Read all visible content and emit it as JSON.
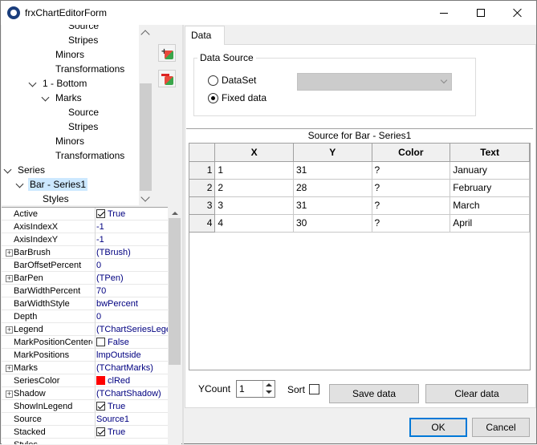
{
  "window": {
    "title": "frxChartEditorForm"
  },
  "tree": {
    "items": [
      {
        "label": "Source",
        "indent": 4,
        "arrow": false
      },
      {
        "label": "Stripes",
        "indent": 4,
        "arrow": false
      },
      {
        "label": "Minors",
        "indent": 3,
        "arrow": false
      },
      {
        "label": "Transformations",
        "indent": 3,
        "arrow": false
      },
      {
        "label": "1 - Bottom",
        "indent": 2,
        "arrow": true
      },
      {
        "label": "Marks",
        "indent": 3,
        "arrow": true
      },
      {
        "label": "Source",
        "indent": 4,
        "arrow": false
      },
      {
        "label": "Stripes",
        "indent": 4,
        "arrow": false
      },
      {
        "label": "Minors",
        "indent": 3,
        "arrow": false
      },
      {
        "label": "Transformations",
        "indent": 3,
        "arrow": false
      },
      {
        "label": "Series",
        "indent": 0,
        "arrow": true
      },
      {
        "label": "Bar - Series1",
        "indent": 1,
        "arrow": true,
        "selected": true
      },
      {
        "label": "Styles",
        "indent": 2,
        "arrow": false
      }
    ]
  },
  "toolbar": {
    "add_icon": "add-series-icon",
    "remove_icon": "remove-series-icon"
  },
  "inspector": {
    "properties": [
      {
        "name": "Active",
        "value": "True",
        "type": "check",
        "checked": true
      },
      {
        "name": "AxisIndexX",
        "value": "-1"
      },
      {
        "name": "AxisIndexY",
        "value": "-1"
      },
      {
        "name": "BarBrush",
        "value": "(TBrush)",
        "expandable": true
      },
      {
        "name": "BarOffsetPercent",
        "value": "0"
      },
      {
        "name": "BarPen",
        "value": "(TPen)",
        "expandable": true
      },
      {
        "name": "BarWidthPercent",
        "value": "70"
      },
      {
        "name": "BarWidthStyle",
        "value": "bwPercent"
      },
      {
        "name": "Depth",
        "value": "0"
      },
      {
        "name": "Legend",
        "value": "(TChartSeriesLege",
        "expandable": true
      },
      {
        "name": "MarkPositionCentere",
        "value": "False",
        "type": "check",
        "checked": false
      },
      {
        "name": "MarkPositions",
        "value": "lmpOutside"
      },
      {
        "name": "Marks",
        "value": "(TChartMarks)",
        "expandable": true
      },
      {
        "name": "SeriesColor",
        "value": "clRed",
        "type": "color",
        "color": "#ff0000"
      },
      {
        "name": "Shadow",
        "value": "(TChartShadow)",
        "expandable": true
      },
      {
        "name": "ShowInLegend",
        "value": "True",
        "type": "check",
        "checked": true
      },
      {
        "name": "Source",
        "value": "Source1"
      },
      {
        "name": "Stacked",
        "value": "True",
        "type": "check",
        "checked": true
      },
      {
        "name": "Styles",
        "value": ""
      }
    ]
  },
  "tabs": {
    "data": "Data"
  },
  "data_source": {
    "legend": "Data Source",
    "dataset_label": "DataSet",
    "fixed_label": "Fixed data",
    "selected": "fixed",
    "dataset_value": ""
  },
  "grid": {
    "caption": "Source for Bar - Series1",
    "columns": [
      "X",
      "Y",
      "Color",
      "Text"
    ],
    "rows": [
      {
        "num": "1",
        "x": "1",
        "y": "31",
        "color": "?",
        "text": "January"
      },
      {
        "num": "2",
        "x": "2",
        "y": "28",
        "color": "?",
        "text": "February"
      },
      {
        "num": "3",
        "x": "3",
        "y": "31",
        "color": "?",
        "text": "March"
      },
      {
        "num": "4",
        "x": "4",
        "y": "30",
        "color": "?",
        "text": "April"
      }
    ]
  },
  "footer": {
    "ycount_label": "YCount",
    "ycount_value": "1",
    "sort_label": "Sort",
    "save_label": "Save data",
    "clear_label": "Clear data"
  },
  "dialog": {
    "ok_label": "OK",
    "cancel_label": "Cancel"
  }
}
